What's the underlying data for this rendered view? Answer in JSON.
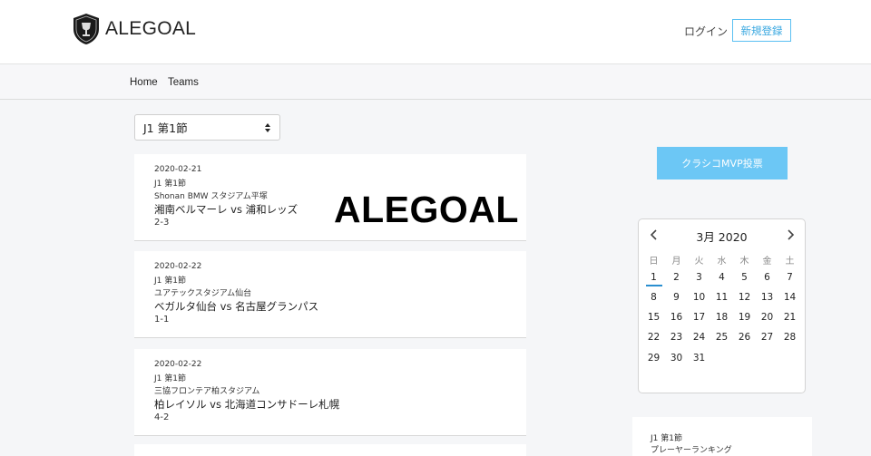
{
  "header": {
    "brand": "ALEGOAL",
    "login_label": "ログイン",
    "signup_label": "新規登録"
  },
  "nav": {
    "items": [
      {
        "label": "Home"
      },
      {
        "label": "Teams"
      }
    ]
  },
  "round_select": {
    "selected": "J1 第1節"
  },
  "matches": [
    {
      "date": "2020-02-21",
      "round": "J1 第1節",
      "stadium": "Shonan BMW スタジアム平塚",
      "teams": "湘南ベルマーレ vs 浦和レッズ",
      "score": "2-3",
      "overlay": "ALEGOAL"
    },
    {
      "date": "2020-02-22",
      "round": "J1 第1節",
      "stadium": "ユアテックスタジアム仙台",
      "teams": "ベガルタ仙台 vs 名古屋グランパス",
      "score": "1-1"
    },
    {
      "date": "2020-02-22",
      "round": "J1 第1節",
      "stadium": "三協フロンテア柏スタジアム",
      "teams": "柏レイソル vs 北海道コンサドーレ札幌",
      "score": "4-2"
    }
  ],
  "mvp_button": {
    "label": "クラシコMVP投票"
  },
  "calendar": {
    "title": "3月 2020",
    "weekdays": [
      "日",
      "月",
      "火",
      "水",
      "木",
      "金",
      "土"
    ],
    "weeks": [
      [
        "1",
        "2",
        "3",
        "4",
        "5",
        "6",
        "7"
      ],
      [
        "8",
        "9",
        "10",
        "11",
        "12",
        "13",
        "14"
      ],
      [
        "15",
        "16",
        "17",
        "18",
        "19",
        "20",
        "21"
      ],
      [
        "22",
        "23",
        "24",
        "25",
        "26",
        "27",
        "28"
      ],
      [
        "29",
        "30",
        "31"
      ]
    ],
    "today": "1",
    "accent": "#2a8fd0"
  },
  "ranking": {
    "round": "J1 第1節",
    "title": "プレーヤーランキング"
  },
  "colors": {
    "primary": "#6cc7f5",
    "signup_border": "#5bc0f2"
  }
}
